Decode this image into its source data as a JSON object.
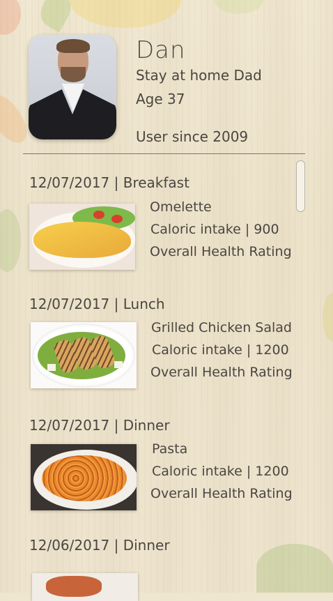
{
  "profile": {
    "name": "Dan",
    "role": "Stay at home Dad",
    "age": "Age 37",
    "since": "User since 2009"
  },
  "meals": [
    {
      "header": "12/07/2017 | Breakfast",
      "dish": "Omelette",
      "calories": "Caloric intake | 900",
      "rating": "Overall Health Rating"
    },
    {
      "header": "12/07/2017 | Lunch",
      "dish": "Grilled Chicken Salad",
      "calories": "Caloric intake | 1200",
      "rating": "Overall Health Rating"
    },
    {
      "header": "12/07/2017 | Dinner",
      "dish": "Pasta",
      "calories": "Caloric intake | 1200",
      "rating": "Overall Health Rating"
    },
    {
      "header": "12/06/2017 | Dinner"
    }
  ]
}
